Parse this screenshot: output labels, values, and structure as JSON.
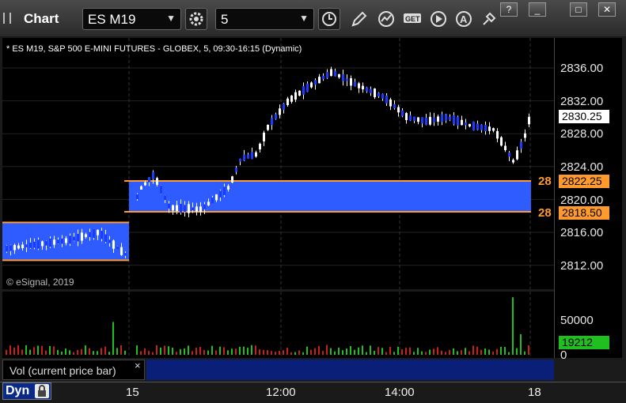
{
  "window": {
    "title": "Chart",
    "minimize": "_",
    "maximize": "□",
    "close": "✕",
    "help": "?"
  },
  "toolbar": {
    "symbol": "ES M19",
    "interval": "5"
  },
  "chart": {
    "symbol_line": "* ES M19, S&P 500 E-MINI FUTURES - GLOBEX, 5, 09:30-16:15 (Dynamic)",
    "copyright": "© eSignal, 2019",
    "price_labels": [
      "2836.00",
      "2832.00",
      "2828.00",
      "2824.00",
      "2820.00",
      "2816.00",
      "2812.00"
    ],
    "last_price": "2830.25",
    "level_upper": "2822.25",
    "level_lower": "2818.50",
    "level_left_upper": "28",
    "level_left_lower": "28",
    "vol_label": "50000",
    "vol_zero": "0",
    "vol_current": "19212",
    "vol_study": "Vol (current price bar)",
    "vol_close": "×",
    "time_labels": [
      "15",
      "12:00",
      "14:00",
      "18"
    ],
    "dyn": "Dyn"
  },
  "colors": {
    "up": "#ffffff",
    "down": "#1a3cff",
    "zone": "#2f5cff",
    "level": "#ff9a2e",
    "vol_up": "#1fbf1f",
    "vol_down": "#c8201c"
  }
}
